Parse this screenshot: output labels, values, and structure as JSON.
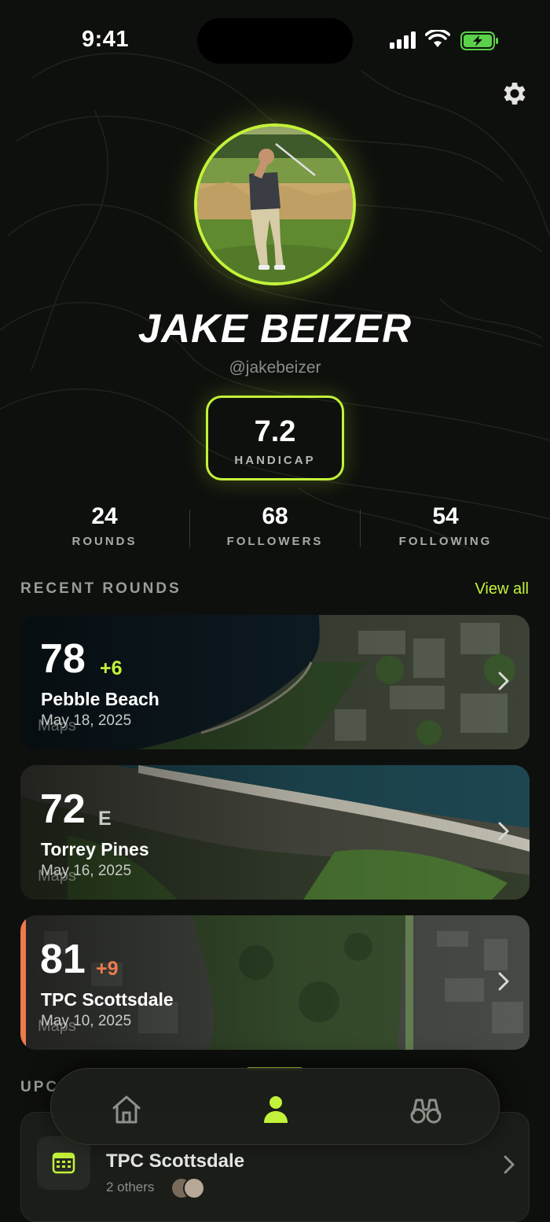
{
  "status_bar": {
    "time": "9:41"
  },
  "profile": {
    "name": "JAKE BEIZER",
    "handle": "@jakebeizer",
    "handicap": {
      "value": "7.2",
      "label": "HANDICAP"
    }
  },
  "stats": [
    {
      "value": "24",
      "label": "ROUNDS"
    },
    {
      "value": "68",
      "label": "FOLLOWERS"
    },
    {
      "value": "54",
      "label": "FOLLOWING"
    }
  ],
  "recent_rounds": {
    "title": "RECENT ROUNDS",
    "view_all": "View all",
    "rounds": [
      {
        "score": "78",
        "diff": "+6",
        "course": "Pebble Beach",
        "date": "May 18, 2025",
        "watermark": "Maps"
      },
      {
        "score": "72",
        "diff": "E",
        "course": "Torrey Pines",
        "date": "May 16, 2025",
        "watermark": "Maps"
      },
      {
        "score": "81",
        "diff": "+9",
        "course": "TPC Scottsdale",
        "date": "May 10, 2025",
        "watermark": "Maps"
      }
    ]
  },
  "upcoming": {
    "title": "UPC",
    "course": "TPC Scottsdale",
    "subtitle": "2 others"
  },
  "tabs": [
    {
      "name": "home",
      "icon": "house-icon"
    },
    {
      "name": "profile",
      "icon": "person-icon",
      "active": true
    },
    {
      "name": "discover",
      "icon": "binoculars-icon"
    }
  ],
  "colors": {
    "accent": "#c3f23a",
    "over_par": "#ee7a4c",
    "background": "#0e100d"
  }
}
